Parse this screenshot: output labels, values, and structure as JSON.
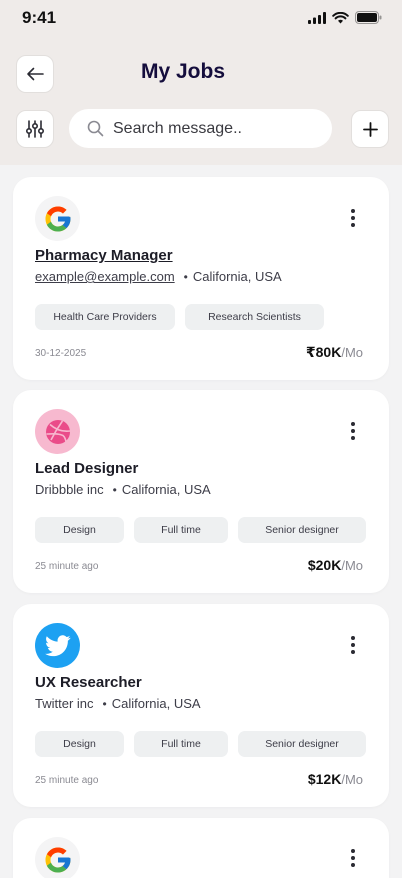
{
  "status_bar": {
    "time": "9:41"
  },
  "header": {
    "title": "My Jobs"
  },
  "search": {
    "placeholder": "Search message.."
  },
  "jobs": [
    {
      "logo": "google-logo-icon",
      "title": "Pharmacy Manager",
      "company": "example@example.com",
      "location": "California, USA",
      "tags": [
        "Health Care Providers",
        "Research Scientists"
      ],
      "posted": "30-12-2025",
      "salary": "₹80K",
      "period": "/Mo"
    },
    {
      "logo": "dribbble-logo-icon",
      "title": "Lead Designer",
      "company": "Dribbble inc",
      "location": "California, USA",
      "tags": [
        "Design",
        "Full time",
        "Senior designer"
      ],
      "posted": "25 minute ago",
      "salary": "$20K",
      "period": "/Mo"
    },
    {
      "logo": "twitter-logo-icon",
      "title": "UX Researcher",
      "company": "Twitter inc",
      "location": "California, USA",
      "tags": [
        "Design",
        "Full time",
        "Senior designer"
      ],
      "posted": "25 minute ago",
      "salary": "$12K",
      "period": "/Mo"
    },
    {
      "logo": "google-logo-icon"
    }
  ],
  "colors": {
    "title": "#140d3c",
    "header_bg": "#efebe9",
    "page_bg": "#f3f3f4",
    "tag_bg": "#eef0f1",
    "dribbble": "#ea4c89",
    "twitter": "#1da1f2"
  }
}
